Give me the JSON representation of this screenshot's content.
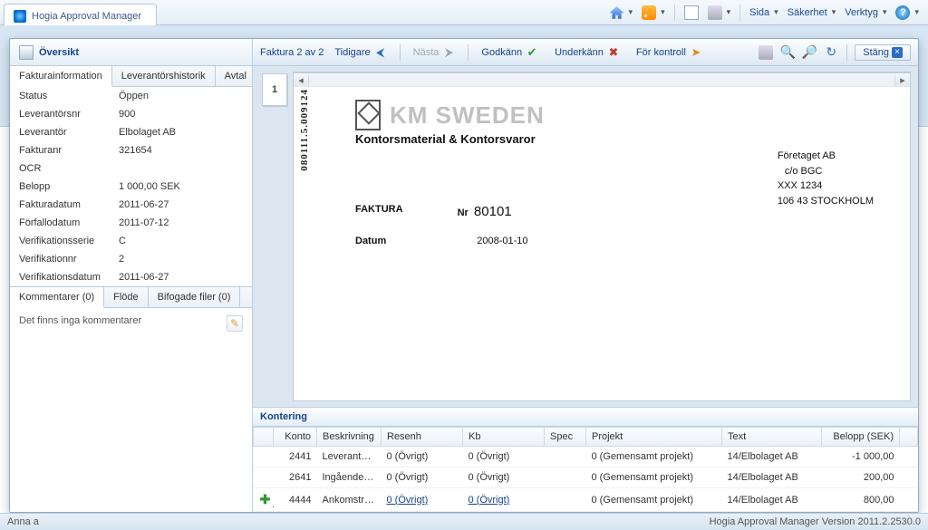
{
  "browser": {
    "tab_title": "Hogia Approval Manager",
    "menus": {
      "page": "Sida",
      "safety": "Säkerhet",
      "tools": "Verktyg"
    }
  },
  "overview": {
    "title": "Översikt",
    "tabs": {
      "info": "Fakturainformation",
      "history": "Leverantörshistorik",
      "contract": "Avtal"
    },
    "fields": {
      "status_l": "Status",
      "status_v": "Öppen",
      "vendno_l": "Leverantörsnr",
      "vendno_v": "900",
      "vendor_l": "Leverantör",
      "vendor_v": "Elbolaget AB",
      "invno_l": "Fakturanr",
      "invno_v": "321654",
      "ocr_l": "OCR",
      "ocr_v": "",
      "amount_l": "Belopp",
      "amount_v": "1 000,00 SEK",
      "invdate_l": "Fakturadatum",
      "invdate_v": "2011-06-27",
      "due_l": "Förfallodatum",
      "due_v": "2011-07-12",
      "series_l": "Verifikationsserie",
      "series_v": "C",
      "verno_l": "Verifikationnr",
      "verno_v": "2",
      "verdate_l": "Verifikationsdatum",
      "verdate_v": "2011-06-27"
    },
    "subtabs": {
      "comments": "Kommentarer (0)",
      "flow": "Flöde",
      "attach": "Bifogade filer (0)"
    },
    "no_comments": "Det finns inga kommentarer"
  },
  "toolbar": {
    "counter": "Faktura 2 av 2",
    "prev": "Tidigare",
    "next": "Nästa",
    "approve": "Godkänn",
    "reject": "Underkänn",
    "control": "För kontroll",
    "close": "Stäng"
  },
  "thumb_page": "1",
  "document": {
    "vertical_code": "080111.5.009124",
    "brand": "KM SWEDEN",
    "brand_sub": "Kontorsmaterial & Kontorsvaror",
    "addr1": "Företaget AB",
    "addr2": "c/o BGC",
    "addr3": "XXX 1234",
    "addr4": "106 43  STOCKHOLM",
    "faktura": "FAKTURA",
    "nr_l": "Nr",
    "nr_v": "80101",
    "datum_l": "Datum",
    "datum_v": "2008-01-10"
  },
  "kontering": {
    "title": "Kontering",
    "headers": {
      "konto": "Konto",
      "beskriv": "Beskrivning",
      "resenh": "Resenh",
      "kb": "Kb",
      "spec": "Spec",
      "projekt": "Projekt",
      "text": "Text",
      "belopp": "Belopp (SEK)"
    },
    "rows": [
      {
        "konto": "2441",
        "beskriv": "Leverantörsskulder,ankomst",
        "resenh": "0 (Övrigt)",
        "kb": "0 (Övrigt)",
        "spec": "",
        "projekt": "0 (Gemensamt projekt)",
        "text": "14/Elbolaget AB",
        "belopp": "-1 000,00"
      },
      {
        "konto": "2641",
        "beskriv": "Ingående moms",
        "resenh": "0 (Övrigt)",
        "kb": "0 (Övrigt)",
        "spec": "",
        "projekt": "0 (Gemensamt projekt)",
        "text": "14/Elbolaget AB",
        "belopp": "200,00"
      },
      {
        "konto": "4444",
        "beskriv": "Ankomstreg. motkonto",
        "resenh": "0 (Övrigt)",
        "kb": "0 (Övrigt)",
        "spec": "",
        "projekt": "0 (Gemensamt projekt)",
        "text": "14/Elbolaget AB",
        "belopp": "800,00"
      }
    ]
  },
  "status": {
    "user": "Anna a",
    "version": "Hogia Approval Manager   Version 2011.2.2530.0"
  }
}
